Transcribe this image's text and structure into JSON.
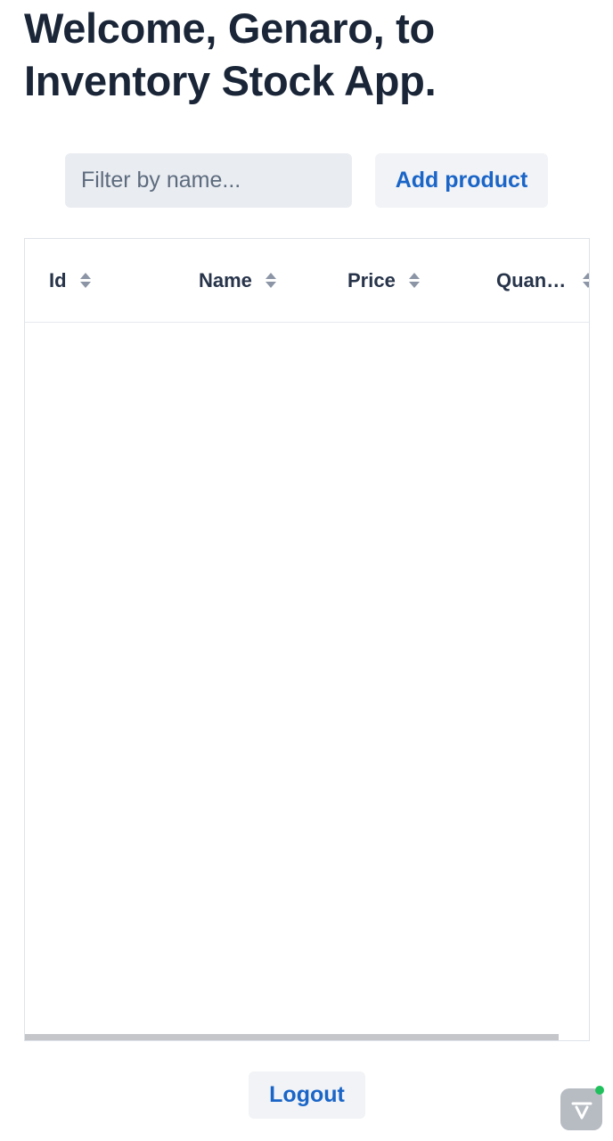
{
  "header": {
    "title": "Welcome, Genaro, to Inventory Stock App."
  },
  "toolbar": {
    "filter_placeholder": "Filter by name...",
    "filter_value": "",
    "add_product_label": "Add product"
  },
  "grid": {
    "columns": [
      {
        "label": "Id",
        "sortable": true
      },
      {
        "label": "Name",
        "sortable": true
      },
      {
        "label": "Price",
        "sortable": true
      },
      {
        "label": "Quantity",
        "sortable": true
      }
    ],
    "rows": []
  },
  "footer": {
    "logout_label": "Logout"
  },
  "colors": {
    "accent": "#1a65c7",
    "heading": "#1a2638",
    "input_bg": "#e9ecf1",
    "button_bg": "#f1f3f6",
    "status_dot": "#20c05c"
  },
  "icons": {
    "sort": "sort-arrows-icon",
    "dev_badge": "dev-tools-icon"
  }
}
